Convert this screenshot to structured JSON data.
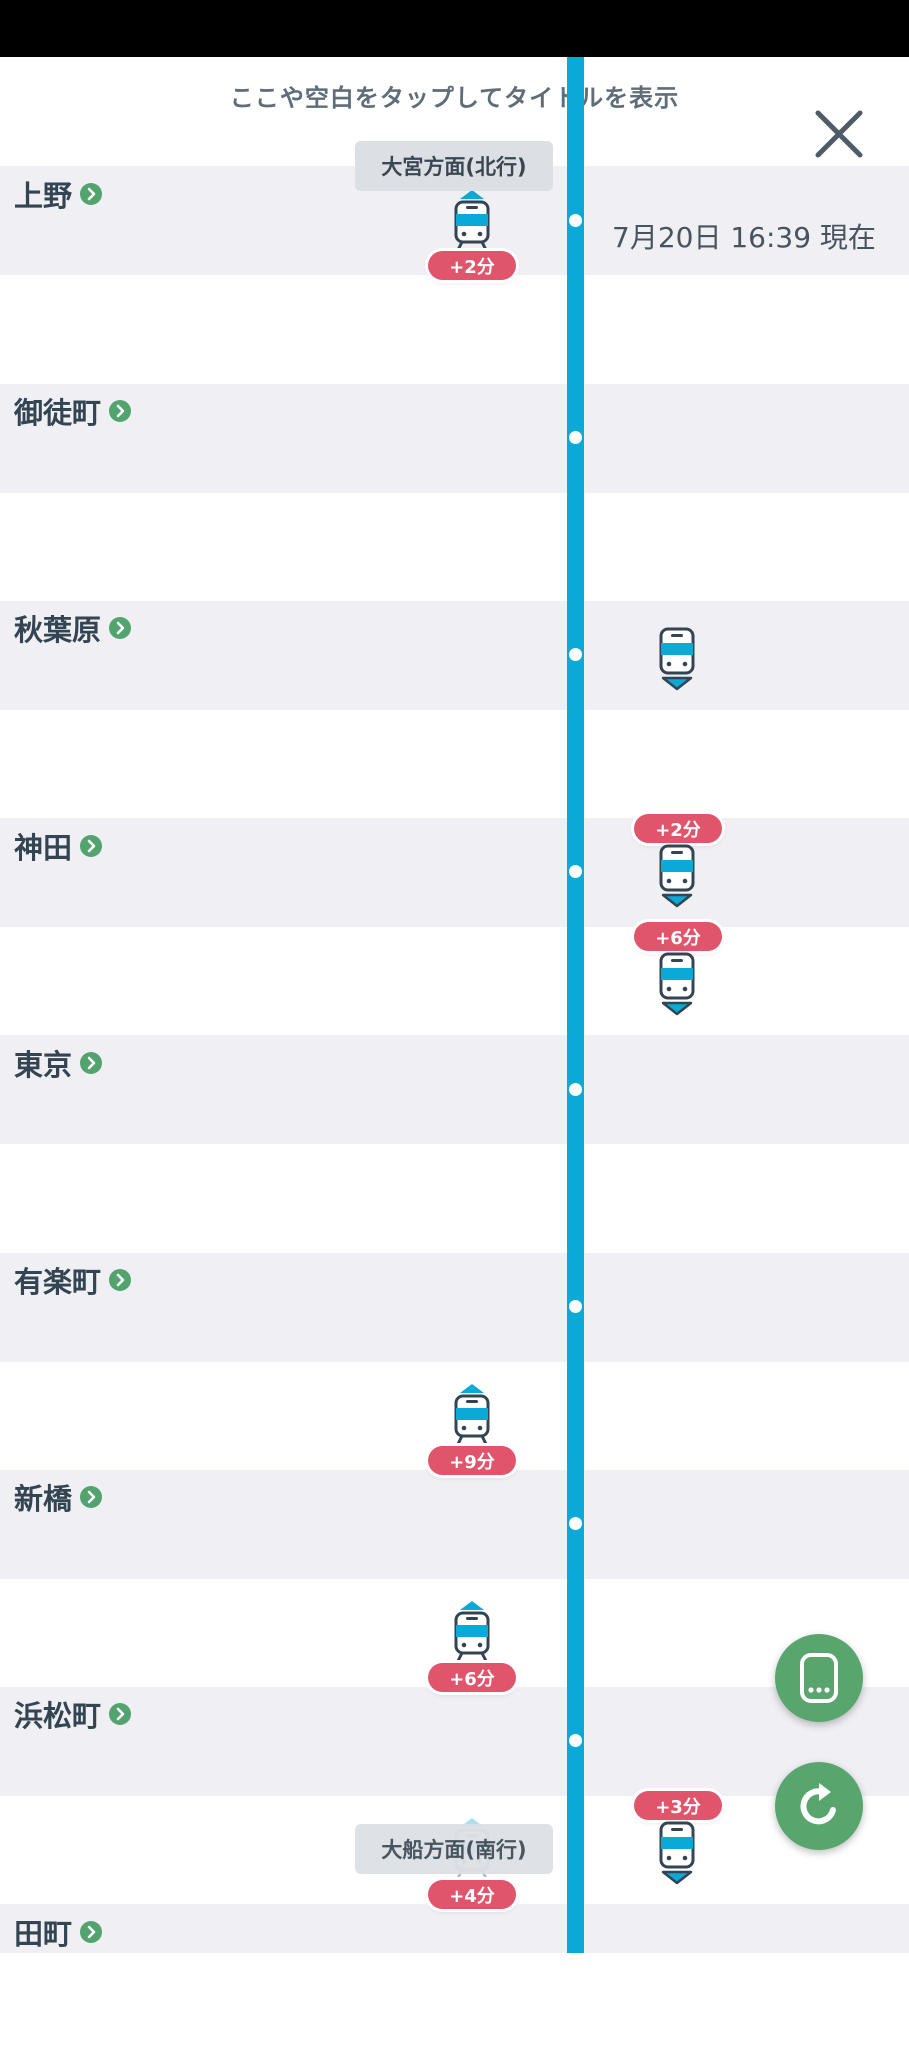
{
  "header": {
    "tap_hint": "ここや空白をタップしてタイトルを表示",
    "close_icon": "close-icon",
    "timestamp": "7月20日 16:39 現在"
  },
  "directions": {
    "north": "大宮方面(北行)",
    "south": "大船方面(南行)"
  },
  "stations": [
    {
      "name": "上野"
    },
    {
      "name": "御徒町"
    },
    {
      "name": "秋葉原"
    },
    {
      "name": "神田"
    },
    {
      "name": "東京"
    },
    {
      "name": "有楽町"
    },
    {
      "name": "新橋"
    },
    {
      "name": "浜松町"
    },
    {
      "name": "田町"
    }
  ],
  "trains": {
    "northbound": [
      {
        "station": "上野",
        "delay": "+2分"
      },
      {
        "between": "有楽町-新橋",
        "delay": "+9分"
      },
      {
        "between": "新橋-浜松町",
        "delay": "+6分"
      },
      {
        "between": "浜松町-田町",
        "delay": "+4分"
      }
    ],
    "southbound": [
      {
        "station": "秋葉原",
        "delay": ""
      },
      {
        "station": "神田",
        "delay": "+2分"
      },
      {
        "between": "神田-東京",
        "delay": "+6分"
      },
      {
        "between": "浜松町-田町",
        "delay": "+3分"
      }
    ]
  },
  "fab": {
    "train_list_icon": "train-front-icon",
    "refresh_icon": "refresh-icon"
  },
  "colors": {
    "line": "#0aa9d6",
    "delay_badge": "#e0556c",
    "accent_green": "#58a66e",
    "station_band": "#efeff4"
  }
}
